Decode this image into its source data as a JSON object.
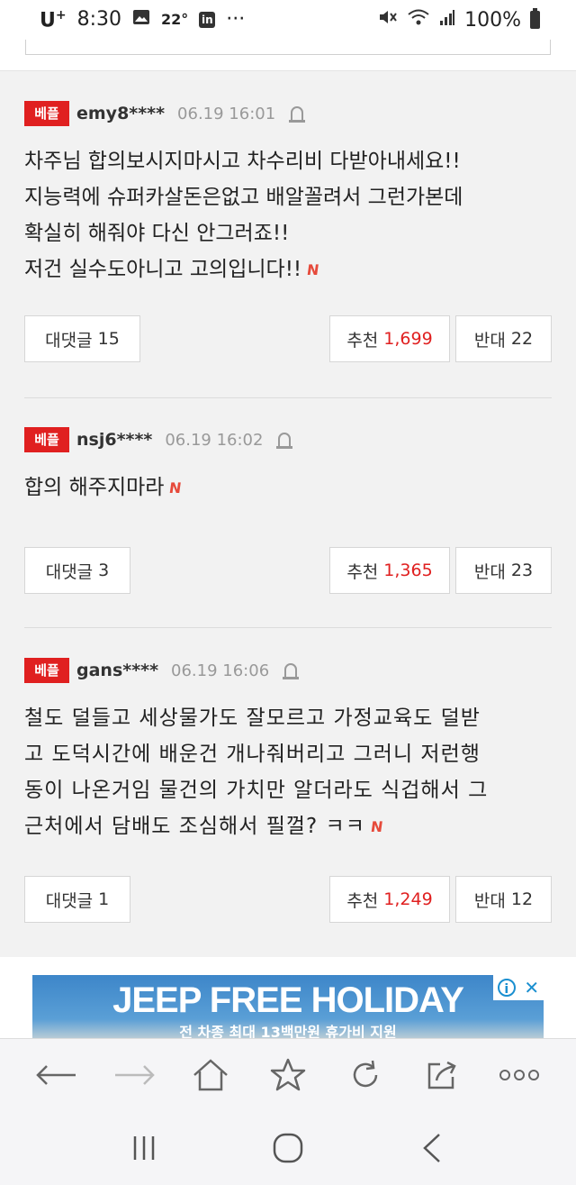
{
  "status_bar": {
    "carrier": "U",
    "carrier_sup": "+",
    "time": "8:30",
    "temp": "22°",
    "more": "···",
    "battery": "100%"
  },
  "comments": [
    {
      "badge": "베플",
      "user": "emy8****",
      "date": "06.19 16:01",
      "lines": [
        "차주님 합의보시지마시고 차수리비 다받아내세요!!",
        "지능력에 슈퍼카살돈은없고 배알꼴려서 그런가본데",
        "확실히 해줘야 다신 안그러죠!!",
        "저건 실수도아니고 고의입니다!!"
      ],
      "reply_label": "대댓글",
      "reply_count": "15",
      "like_label": "추천",
      "like_count": "1,699",
      "dislike_label": "반대",
      "dislike_count": "22"
    },
    {
      "badge": "베플",
      "user": "nsj6****",
      "date": "06.19 16:02",
      "lines": [
        "합의 해주지마라"
      ],
      "reply_label": "대댓글",
      "reply_count": "3",
      "like_label": "추천",
      "like_count": "1,365",
      "dislike_label": "반대",
      "dislike_count": "23"
    },
    {
      "badge": "베플",
      "user": "gans****",
      "date": "06.19 16:06",
      "lines": [
        "철도 덜들고 세상물가도 잘모르고 가정교육도 덜받",
        "고 도덕시간에 배운건 개나줘버리고 그러니 저런행",
        "동이 나온거임 물건의 가치만 알더라도 식겁해서 그",
        "근처에서 담배도 조심해서 필껄? ㅋㅋ"
      ],
      "reply_label": "대댓글",
      "reply_count": "1",
      "like_label": "추천",
      "like_count": "1,249",
      "dislike_label": "반대",
      "dislike_count": "12"
    }
  ],
  "new_mark": "N",
  "ad": {
    "title": "JEEP FREE HOLIDAY",
    "subtitle": "전 차종 최대 13백만원 휴가비 지원"
  },
  "colors": {
    "badge": "#e02020",
    "like_count": "#e02020",
    "new_mark": "#e64a3b",
    "ad_info": "#1a8fd0"
  },
  "browser_toolbar_icons": [
    "back-arrow-icon",
    "forward-arrow-icon",
    "home-icon",
    "bookmark-star-icon",
    "refresh-icon",
    "share-icon",
    "more-dots-icon"
  ],
  "system_nav_icons": [
    "recent-apps-icon",
    "home-circle-icon",
    "back-chevron-icon"
  ]
}
